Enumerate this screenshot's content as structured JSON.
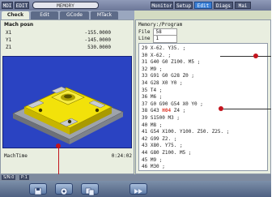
{
  "topbar": {
    "left_labels": [
      "MDI",
      "EDIT",
      "MEMORY"
    ],
    "right_tabs": [
      "Monitor",
      "Setup",
      "Edit",
      "Diags",
      "Mai"
    ],
    "active_right_tab": "Edit"
  },
  "tabs": [
    {
      "label": "Check",
      "active": true
    },
    {
      "label": "Edit",
      "active": false
    },
    {
      "label": "GCode",
      "active": false
    },
    {
      "label": "MTack",
      "active": false
    }
  ],
  "position": {
    "title": "Mach posn",
    "axes": [
      {
        "label": "X1",
        "value": "-155.0000"
      },
      {
        "label": "Y1",
        "value": "-145.0000"
      },
      {
        "label": "Z1",
        "value": "530.0000"
      }
    ]
  },
  "machine_time": {
    "label": "MachTime",
    "value": "0:24:02"
  },
  "program": {
    "path": "Memory:/Program",
    "file_label": "File",
    "file_value": "58",
    "line_label": "Line",
    "line_value": "1",
    "code_lines": [
      "29 X-62. Y35. ;",
      "30 X-62. ;",
      "31 G40 G0 Z100. M5 ;",
      "32 M9 ;",
      "33 G91 G0 G28 Z0 ;",
      "34 G28 X0 Y0 ;",
      "35 T4 ;",
      "36 M6 ;",
      "37 G0 G90 G54 X0 Y0 ;",
      "38 G43 H04 Z4 ;",
      "39 S1500 M3 ;",
      "40 M8 ;",
      "41 G54 X100. Y100. Z50. Z25. ;",
      "42 G99 Z2. ;",
      "43 X80. Y75. ;",
      "44 G80 Z100. M5 ;",
      "45 M9 ;",
      "46 M30 ;"
    ],
    "highlight_line": 9,
    "highlight_token": "H04"
  },
  "status_strip": {
    "items": [
      "S/N:0",
      "P:1"
    ]
  },
  "softkeys": [
    {
      "icon": "save-icon"
    },
    {
      "icon": "open-icon"
    },
    {
      "icon": "copy-icon"
    },
    {
      "icon": "forward-icon"
    }
  ],
  "colors": {
    "viewport_bg": "#2a43c2",
    "part_yellow": "#f2e20a",
    "part_gray": "#b8bcc4",
    "highlight_text": "#e03a2c",
    "callout_red": "#c3141d"
  }
}
